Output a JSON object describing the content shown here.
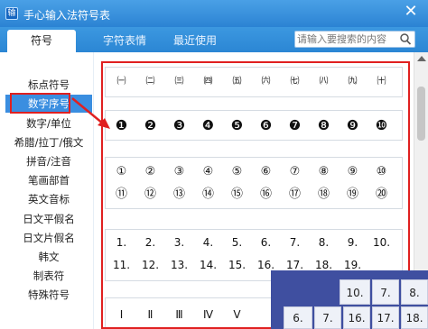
{
  "window": {
    "title": "手心输入法符号表",
    "app_icon": "输",
    "close_glyph": "✕"
  },
  "tabs": [
    {
      "label": "符号",
      "active": true
    },
    {
      "label": "字符表情",
      "active": false
    },
    {
      "label": "最近使用",
      "active": false
    }
  ],
  "search": {
    "placeholder": "请输入要搜索的内容",
    "icon": "search-icon"
  },
  "sidebar": {
    "items": [
      {
        "label": "标点符号"
      },
      {
        "label": "数字序号",
        "selected": true
      },
      {
        "label": "数字/单位"
      },
      {
        "label": "希腊/拉丁/俄文"
      },
      {
        "label": "拼音/注音"
      },
      {
        "label": "笔画部首"
      },
      {
        "label": "英文音标"
      },
      {
        "label": "日文平假名"
      },
      {
        "label": "日文片假名"
      },
      {
        "label": "韩文"
      },
      {
        "label": "制表符"
      },
      {
        "label": "特殊符号"
      }
    ]
  },
  "symbols": {
    "parenthesized": [
      "㈠",
      "㈡",
      "㈢",
      "㈣",
      "㈤",
      "㈥",
      "㈦",
      "㈧",
      "㈨",
      "㈩"
    ],
    "negative_circled": [
      "❶",
      "❷",
      "❸",
      "❹",
      "❺",
      "❻",
      "❼",
      "❽",
      "❾",
      "❿"
    ],
    "circled_row1": [
      "①",
      "②",
      "③",
      "④",
      "⑤",
      "⑥",
      "⑦",
      "⑧",
      "⑨",
      "⑩"
    ],
    "circled_row2": [
      "⑪",
      "⑫",
      "⑬",
      "⑭",
      "⑮",
      "⑯",
      "⑰",
      "⑱",
      "⑲",
      "⑳"
    ],
    "dotted_row1": [
      "1.",
      "2.",
      "3.",
      "4.",
      "5.",
      "6.",
      "7.",
      "8.",
      "9.",
      "10."
    ],
    "dotted_row2": [
      "11.",
      "12.",
      "13.",
      "14.",
      "15.",
      "16.",
      "17.",
      "18.",
      "19.",
      ""
    ],
    "roman_partial": [
      "Ⅰ",
      "Ⅱ",
      "Ⅲ",
      "Ⅳ",
      "Ⅴ"
    ]
  },
  "overlay_keys": [
    "10.",
    "7.",
    "8.",
    "6.",
    "7.",
    "16.",
    "17.",
    "18."
  ],
  "colors": {
    "titlebar": "#2b83d3",
    "selected_item": "#3a8ee0",
    "highlight_red": "#e02020",
    "overlay_bg": "#3f4fa0"
  }
}
